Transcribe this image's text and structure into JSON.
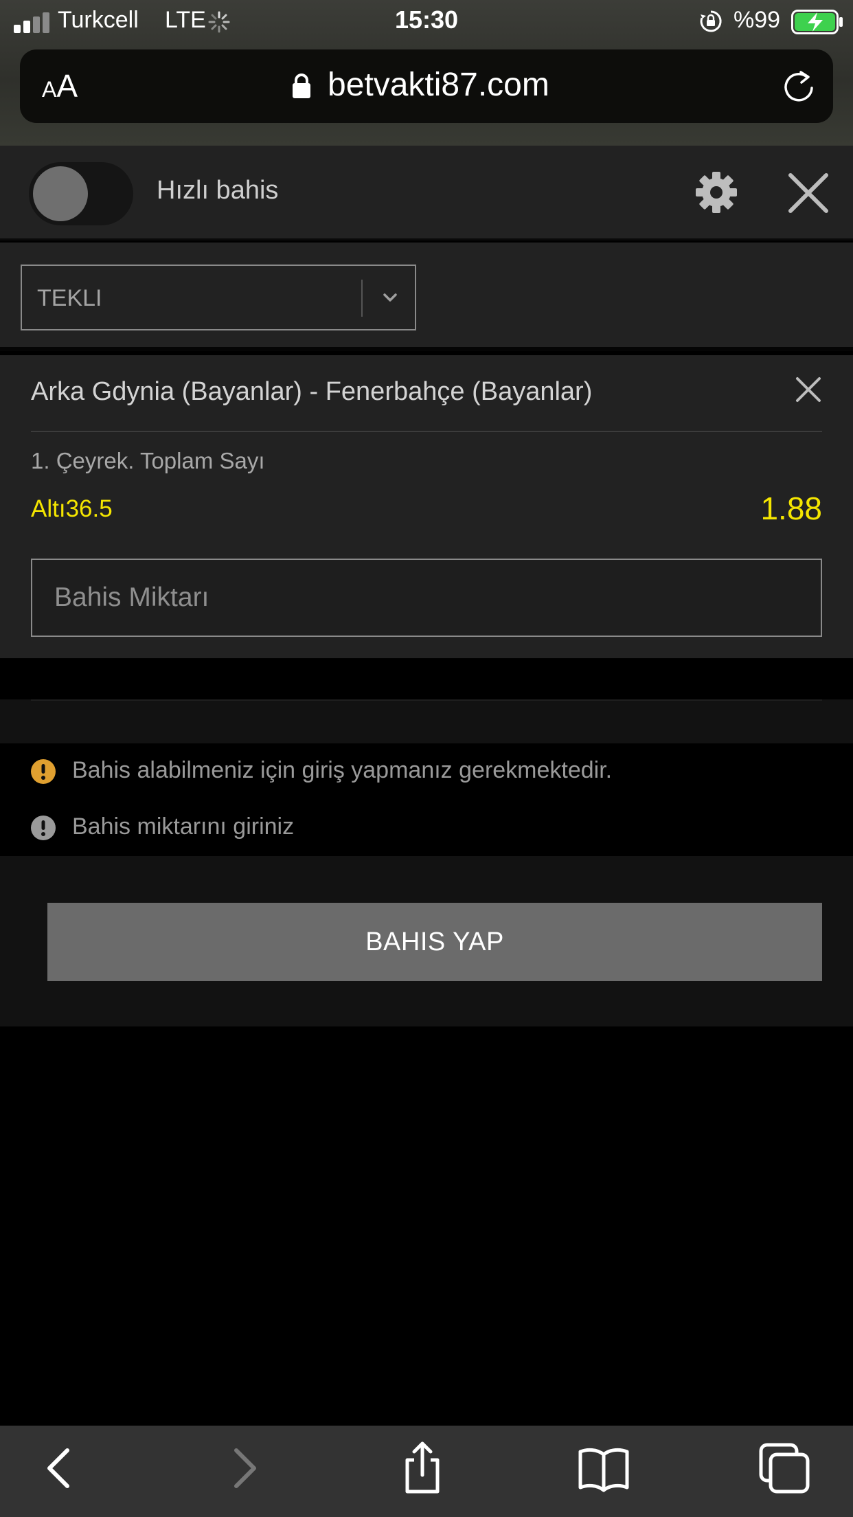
{
  "status_bar": {
    "carrier": "Turkcell",
    "network": "LTE",
    "time": "15:30",
    "battery_percent": "%99"
  },
  "url_bar": {
    "text_size_small": "A",
    "text_size_large": "A",
    "url": "betvakti87.com"
  },
  "bet_slip": {
    "quick_bet_label": "Hızlı bahis",
    "bet_type": "TEKLI",
    "match": "Arka Gdynia (Bayanlar) - Fenerbahçe (Bayanlar)",
    "market": "1. Çeyrek. Toplam Sayı",
    "selection": "Altı36.5",
    "odds": "1.88",
    "stake_placeholder": "Bahis Miktarı",
    "messages": {
      "login_required": "Bahis alabilmeniz için giriş yapmanız gerekmektedir.",
      "enter_amount": "Bahis miktarını giriniz"
    },
    "place_bet_label": "BAHIS YAP"
  },
  "colors": {
    "odds_yellow": "#f5e600",
    "warning_orange": "#e0a030",
    "panel": "#222222",
    "button_gray": "#6b6b6b"
  },
  "icons": {
    "status": [
      "signal-icon",
      "activity-spinner-icon",
      "rotation-lock-icon",
      "battery-charging-icon"
    ],
    "url_bar": [
      "padlock-icon",
      "reload-icon"
    ],
    "panel": [
      "gear-icon",
      "close-icon",
      "chevron-down-icon",
      "warning-icon"
    ],
    "toolbar": [
      "back-icon",
      "forward-icon",
      "share-icon",
      "bookmarks-icon",
      "tabs-icon"
    ]
  }
}
